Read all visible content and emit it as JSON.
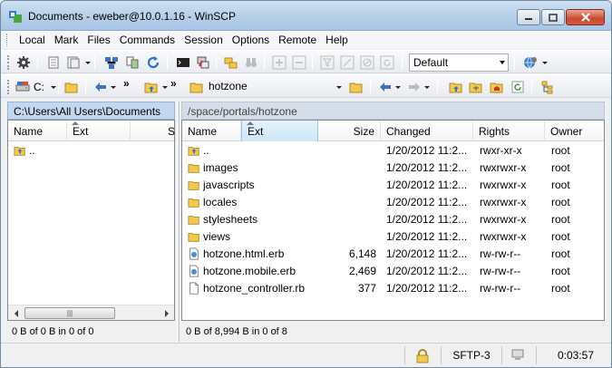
{
  "window": {
    "title": "Documents - eweber@10.0.1.16 - WinSCP"
  },
  "menu": [
    "Local",
    "Mark",
    "Files",
    "Commands",
    "Session",
    "Options",
    "Remote",
    "Help"
  ],
  "toolbar": {
    "transfer_settings": "Default"
  },
  "left_panel": {
    "drive": "C:",
    "path": "C:\\Users\\All Users\\Documents",
    "columns": {
      "name": "Name",
      "ext": "Ext",
      "size": "S"
    },
    "rows": [
      {
        "name": ".."
      }
    ],
    "info": "0 B of 0 B in 0 of 0"
  },
  "right_panel": {
    "folder": "hotzone",
    "path": "/space/portals/hotzone",
    "columns": {
      "name": "Name",
      "ext": "Ext",
      "size": "Size",
      "changed": "Changed",
      "rights": "Rights",
      "owner": "Owner"
    },
    "rows": [
      {
        "name": "..",
        "icon": "parent-folder-icon",
        "size": "",
        "changed": "1/20/2012 11:2...",
        "rights": "rwxr-xr-x",
        "owner": "root"
      },
      {
        "name": "images",
        "icon": "folder-icon",
        "size": "",
        "changed": "1/20/2012 11:2...",
        "rights": "rwxrwxr-x",
        "owner": "root"
      },
      {
        "name": "javascripts",
        "icon": "folder-icon",
        "size": "",
        "changed": "1/20/2012 11:2...",
        "rights": "rwxrwxr-x",
        "owner": "root"
      },
      {
        "name": "locales",
        "icon": "folder-icon",
        "size": "",
        "changed": "1/20/2012 11:2...",
        "rights": "rwxrwxr-x",
        "owner": "root"
      },
      {
        "name": "stylesheets",
        "icon": "folder-icon",
        "size": "",
        "changed": "1/20/2012 11:2...",
        "rights": "rwxrwxr-x",
        "owner": "root"
      },
      {
        "name": "views",
        "icon": "folder-icon",
        "size": "",
        "changed": "1/20/2012 11:2...",
        "rights": "rwxrwxr-x",
        "owner": "root"
      },
      {
        "name": "hotzone.html.erb",
        "icon": "web-file-icon",
        "size": "6,148",
        "changed": "1/20/2012 11:2...",
        "rights": "rw-rw-r--",
        "owner": "root"
      },
      {
        "name": "hotzone.mobile.erb",
        "icon": "web-file-icon",
        "size": "2,469",
        "changed": "1/20/2012 11:2...",
        "rights": "rw-rw-r--",
        "owner": "root"
      },
      {
        "name": "hotzone_controller.rb",
        "icon": "file-icon",
        "size": "377",
        "changed": "1/20/2012 11:2...",
        "rights": "rw-rw-r--",
        "owner": "root"
      }
    ],
    "info": "0 B of 8,994 B in 0 of 8"
  },
  "status": {
    "protocol": "SFTP-3",
    "elapsed": "0:03:57"
  },
  "colors": {
    "folder": "#f2c94c",
    "accent": "#c3d7ee"
  }
}
